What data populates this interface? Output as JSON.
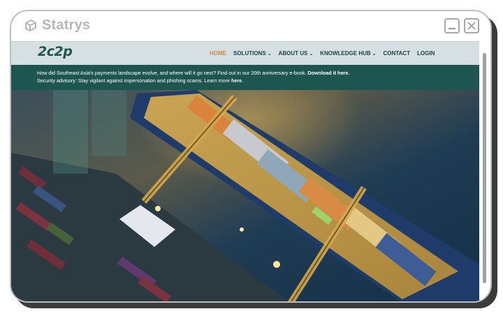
{
  "window": {
    "brand_name": "Statrys",
    "brand_icon": "statrys-logo-icon",
    "minimize_icon": "minimize-icon",
    "close_icon": "close-icon"
  },
  "site": {
    "logo_text": "2c2p",
    "nav": [
      {
        "label": "HOME",
        "active": true,
        "dropdown": false
      },
      {
        "label": "SOLUTIONS",
        "active": false,
        "dropdown": true
      },
      {
        "label": "ABOUT US",
        "active": false,
        "dropdown": true
      },
      {
        "label": "KNOWLEDGE HUB",
        "active": false,
        "dropdown": true
      },
      {
        "label": "CONTACT",
        "active": false,
        "dropdown": false
      },
      {
        "label": "LOGIN",
        "active": false,
        "dropdown": false
      }
    ],
    "announcement": {
      "line1_text": "How did Southeast Asia's payments landscape evolve, and where will it go next? Find out in our 20th anniversary e-book. ",
      "line1_link": "Download it here.",
      "line2_text": "Security advisory: Stay vigilant against impersonation and phishing scams. Learn more ",
      "line2_link": "here",
      "line2_end": "."
    },
    "hero_image": "aerial view of container ship at port at night"
  },
  "colors": {
    "nav_bg": "#d6e0e3",
    "brand_teal": "#1d5651",
    "active_nav": "#c78a3c"
  }
}
